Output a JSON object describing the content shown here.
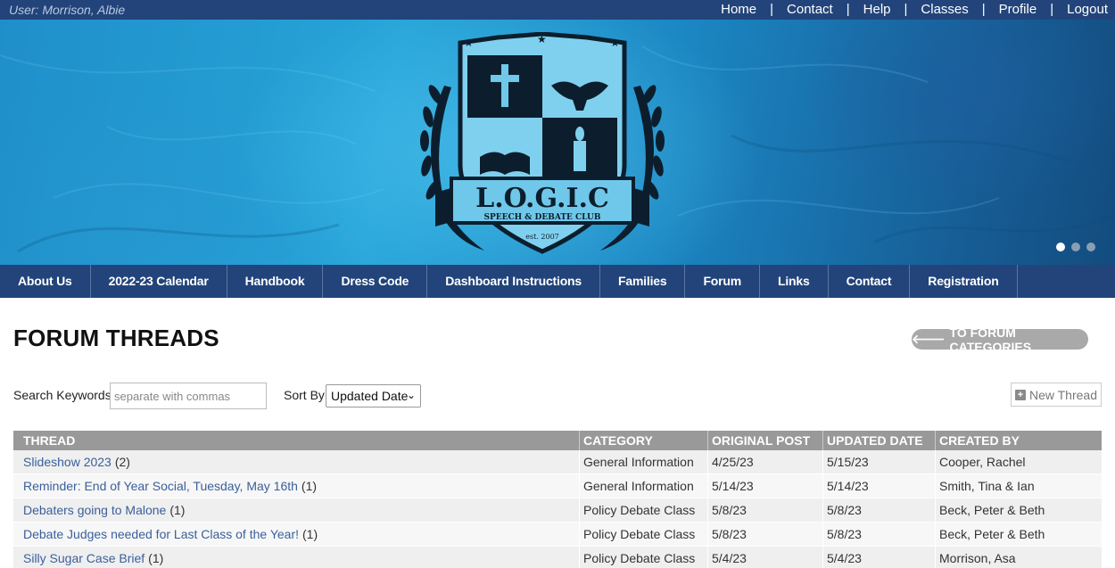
{
  "topbar": {
    "user": "User: Morrison, Albie",
    "links": [
      "Home",
      "Contact",
      "Help",
      "Classes",
      "Profile",
      "Logout"
    ]
  },
  "banner": {
    "crest_title": "L.O.G.I.C",
    "crest_subtitle": "SPEECH & DEBATE CLUB",
    "crest_est": "est. 2007",
    "slide_index": 1,
    "slide_count": 3
  },
  "mainnav": [
    "About Us",
    "2022-23 Calendar",
    "Handbook",
    "Dress Code",
    "Dashboard Instructions",
    "Families",
    "Forum",
    "Links",
    "Contact",
    "Registration"
  ],
  "page": {
    "title": "FORUM THREADS",
    "back_button": "TO FORUM CATEGORIES",
    "search_label": "Search Keywords",
    "search_placeholder": "separate with commas",
    "sort_label": "Sort By",
    "sort_value": "Updated Date",
    "new_thread": "New Thread"
  },
  "table": {
    "headers": [
      "THREAD",
      "CATEGORY",
      "ORIGINAL POST",
      "UPDATED DATE",
      "CREATED BY"
    ],
    "rows": [
      {
        "thread": "Slideshow 2023",
        "count": "(2)",
        "category": "General Information",
        "original": "4/25/23",
        "updated": "5/15/23",
        "created_by": "Cooper, Rachel"
      },
      {
        "thread": "Reminder: End of Year Social, Tuesday, May 16th",
        "count": "(1)",
        "category": "General Information",
        "original": "5/14/23",
        "updated": "5/14/23",
        "created_by": "Smith, Tina & Ian"
      },
      {
        "thread": "Debaters going to Malone",
        "count": "(1)",
        "category": "Policy Debate Class",
        "original": "5/8/23",
        "updated": "5/8/23",
        "created_by": "Beck, Peter & Beth"
      },
      {
        "thread": "Debate Judges needed for Last Class of the Year!",
        "count": "(1)",
        "category": "Policy Debate Class",
        "original": "5/8/23",
        "updated": "5/8/23",
        "created_by": "Beck, Peter & Beth"
      },
      {
        "thread": "Silly Sugar Case Brief",
        "count": "(1)",
        "category": "Policy Debate Class",
        "original": "5/4/23",
        "updated": "5/4/23",
        "created_by": "Morrison, Asa"
      }
    ]
  },
  "colors": {
    "navy": "#22447a",
    "table_header": "#999999",
    "link": "#3a5f9a"
  },
  "icons": {
    "back": "arrow-left-icon",
    "new_thread": "plus-square-icon",
    "sort": "chevron-down-icon"
  }
}
